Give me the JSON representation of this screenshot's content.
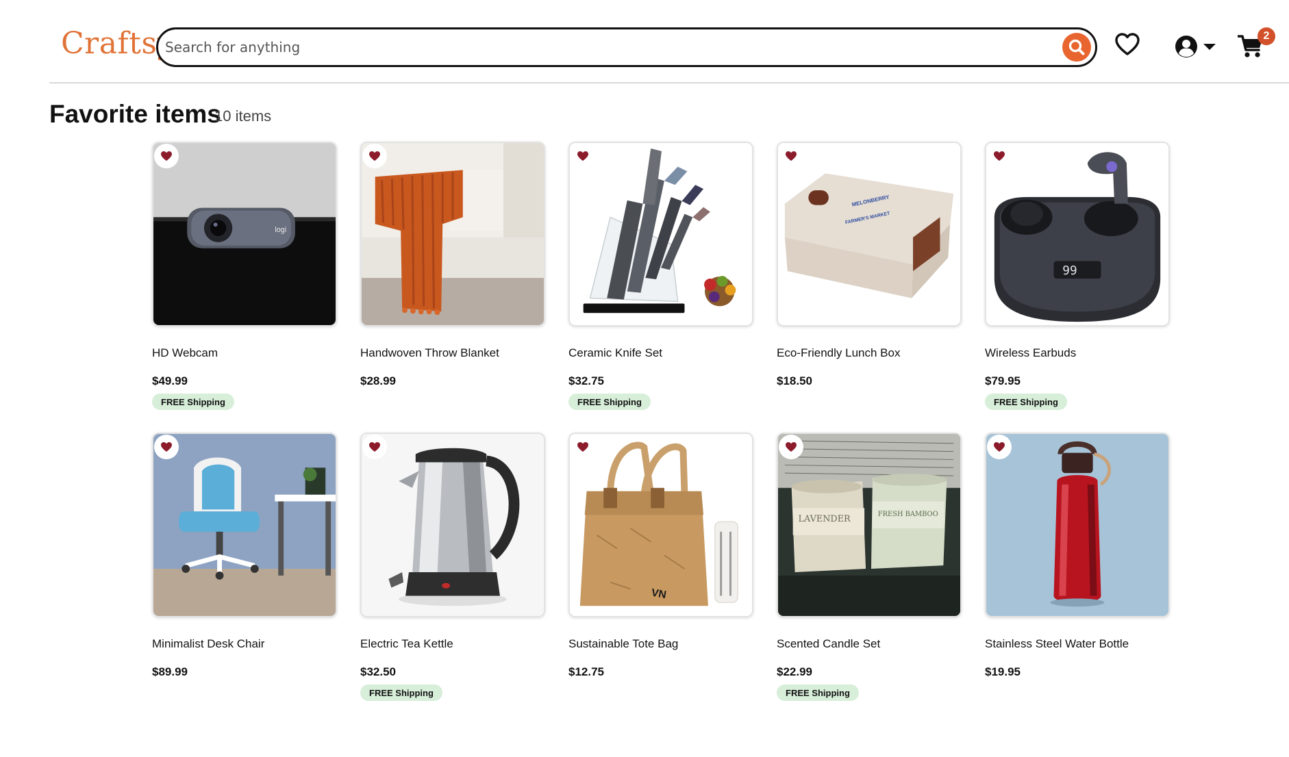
{
  "header": {
    "logo": "Craftsy",
    "search_placeholder": "Search for anything",
    "cart_count": "2"
  },
  "page": {
    "title": "Favorite items",
    "count_label": "10 items"
  },
  "items": [
    {
      "name": "HD Webcam",
      "price": "$49.99",
      "shipping": "FREE Shipping"
    },
    {
      "name": "Handwoven Throw Blanket",
      "price": "$28.99",
      "shipping": ""
    },
    {
      "name": "Ceramic Knife Set",
      "price": "$32.75",
      "shipping": "FREE Shipping"
    },
    {
      "name": "Eco-Friendly Lunch Box",
      "price": "$18.50",
      "shipping": ""
    },
    {
      "name": "Wireless Earbuds",
      "price": "$79.95",
      "shipping": "FREE Shipping"
    },
    {
      "name": "Minimalist Desk Chair",
      "price": "$89.99",
      "shipping": ""
    },
    {
      "name": "Electric Tea Kettle",
      "price": "$32.50",
      "shipping": "FREE Shipping"
    },
    {
      "name": "Sustainable Tote Bag",
      "price": "$12.75",
      "shipping": ""
    },
    {
      "name": "Scented Candle Set",
      "price": "$22.99",
      "shipping": "FREE Shipping"
    },
    {
      "name": "Stainless Steel Water Bottle",
      "price": "$19.95",
      "shipping": ""
    }
  ],
  "product_art": {
    "webcam_brand": "logi",
    "lunchbox_brand_1": "MELONBERRY",
    "lunchbox_brand_2": "FARMER'S MARKET",
    "earbuds_display": "99",
    "candle_1": "LAVENDER",
    "candle_2": "FRESH BAMBOO",
    "tote_brand": "VN"
  },
  "colors": {
    "brand": "#e07337",
    "search_button": "#e8652f",
    "favorite_heart": "#8c1c2b",
    "cart_badge": "#d2502a",
    "shipping_badge": "#d7eed9"
  },
  "icons": {
    "search": "search-icon",
    "favorites": "heart-outline-icon",
    "account": "user-circle-icon",
    "cart": "shopping-cart-icon",
    "favorite_toggle": "heart-filled-icon"
  }
}
